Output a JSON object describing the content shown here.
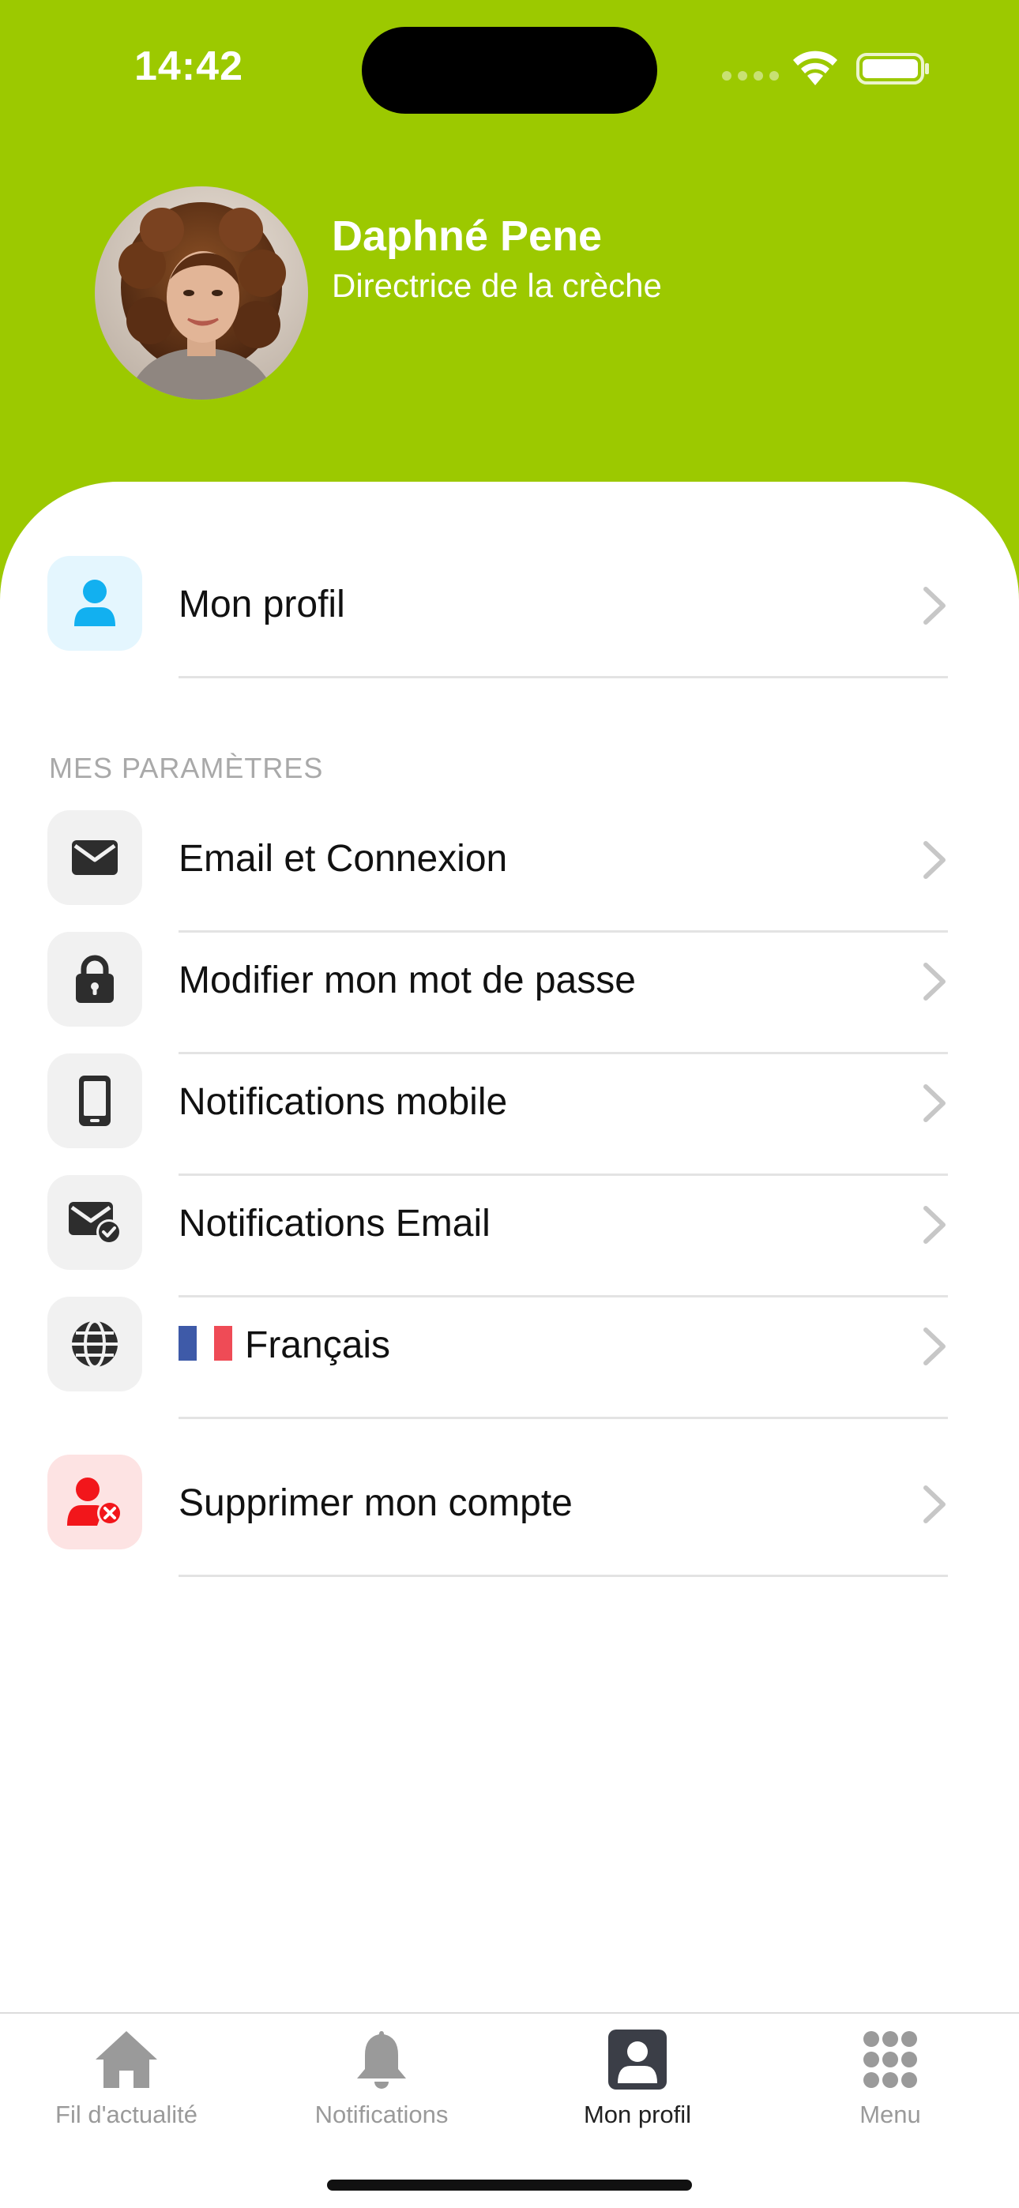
{
  "status_bar": {
    "time": "14:42"
  },
  "profile": {
    "name": "Daphné Pene",
    "role": "Directrice de la crèche"
  },
  "top_item": {
    "label": "Mon profil",
    "icon": "user-icon",
    "icon_color": "#12b0f0",
    "icon_bg": "#e4f6fe"
  },
  "section": {
    "title": "MES PARAMÈTRES"
  },
  "settings": [
    {
      "label": "Email et Connexion",
      "icon": "envelope-icon"
    },
    {
      "label": "Modifier mon mot de passe",
      "icon": "lock-icon"
    },
    {
      "label": "Notifications mobile",
      "icon": "mobile-phone-icon"
    },
    {
      "label": "Notifications Email",
      "icon": "envelope-check-icon"
    },
    {
      "label": "Français",
      "icon": "globe-icon"
    }
  ],
  "danger_item": {
    "label": "Supprimer mon compte",
    "icon": "user-delete-icon",
    "icon_color": "#f2161b",
    "icon_bg": "#fde3e3"
  },
  "tabs": [
    {
      "label": "Fil d'actualité",
      "icon": "home-icon",
      "active": false
    },
    {
      "label": "Notifications",
      "icon": "bell-icon",
      "active": false
    },
    {
      "label": "Mon profil",
      "icon": "profile-card-icon",
      "active": true
    },
    {
      "label": "Menu",
      "icon": "grid-dots-icon",
      "active": false
    }
  ],
  "colors": {
    "header": "#9cc900",
    "icon_dark": "#2d2d2d",
    "chevron": "#c7c7c7",
    "section_title": "#a9a9a9",
    "tab_inactive": "#9a9a9a",
    "tab_active": "#3b3e47"
  }
}
